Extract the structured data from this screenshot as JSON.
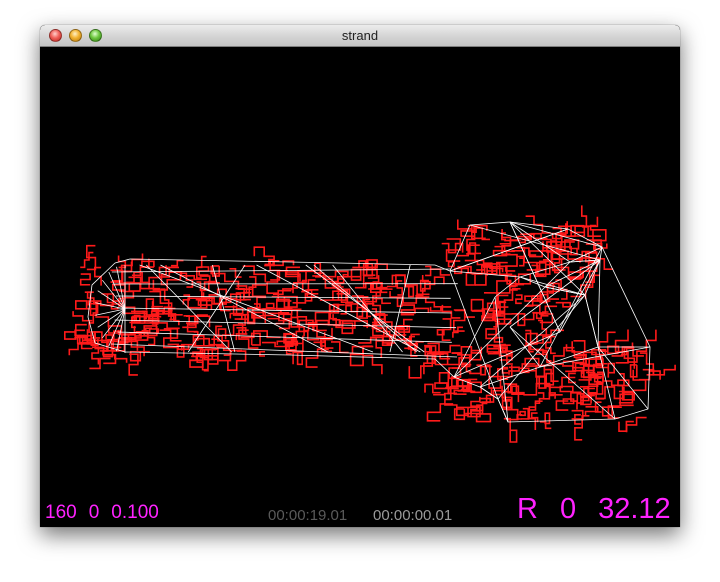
{
  "window": {
    "title": "strand"
  },
  "hud": {
    "left_values": [
      "160",
      "0",
      "0.100"
    ],
    "time_elapsed": "00:00:19.01",
    "time_frame": "00:00:00.01",
    "right_mode": "R",
    "right_value_1": "0",
    "right_value_2": "32.12"
  },
  "colors": {
    "hud_magenta": "#ff22ff",
    "strand_red": "#ff1a1a",
    "mesh_white": "#ffffff",
    "background": "#000000"
  }
}
